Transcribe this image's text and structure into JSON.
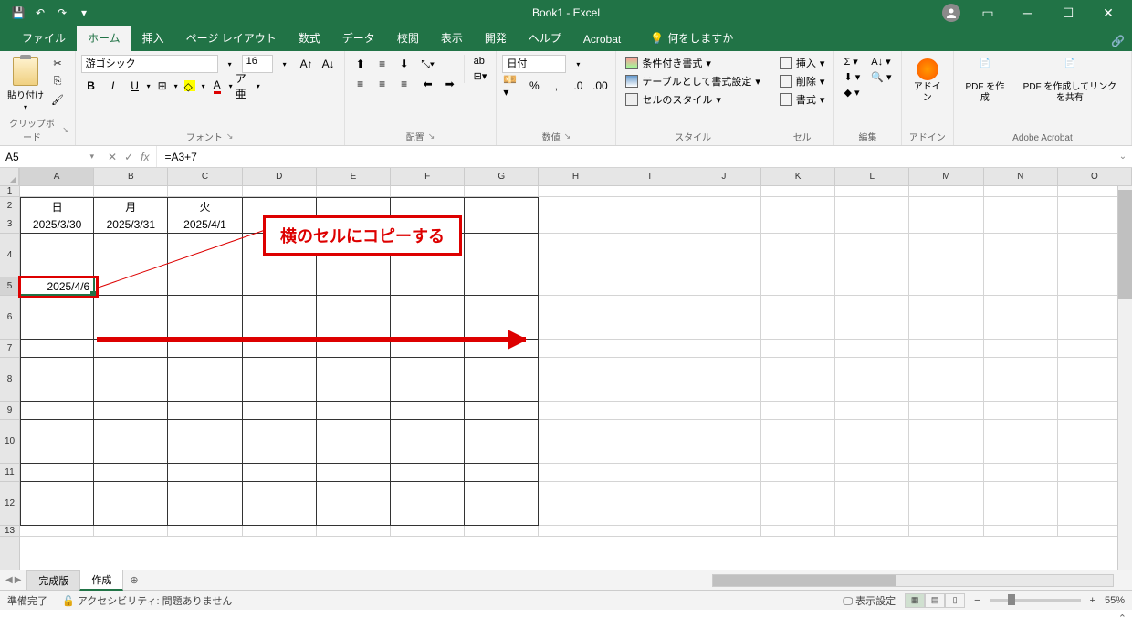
{
  "titlebar": {
    "title": "Book1 - Excel"
  },
  "tabs": {
    "file": "ファイル",
    "home": "ホーム",
    "insert": "挿入",
    "layout": "ページ レイアウト",
    "formulas": "数式",
    "data": "データ",
    "review": "校閲",
    "view": "表示",
    "dev": "開発",
    "help": "ヘルプ",
    "acrobat": "Acrobat",
    "tellme": "何をしますか"
  },
  "ribbon": {
    "paste": "貼り付け",
    "clipboard_label": "クリップボード",
    "font_name": "游ゴシック",
    "font_size": "16",
    "font_label": "フォント",
    "align_label": "配置",
    "wrap": "ab",
    "number_format": "日付",
    "number_label": "数値",
    "cond_fmt": "条件付き書式",
    "table_fmt": "テーブルとして書式設定",
    "cell_style": "セルのスタイル",
    "styles_label": "スタイル",
    "insert_cell": "挿入",
    "delete_cell": "削除",
    "format_cell": "書式",
    "cells_label": "セル",
    "edit_label": "編集",
    "addin": "アドイン",
    "addin_label": "アドイン",
    "pdf_create": "PDF を作成",
    "pdf_share": "PDF を作成してリンクを共有",
    "acrobat_label": "Adobe Acrobat"
  },
  "formula_bar": {
    "cell_ref": "A5",
    "formula": "=A3+7"
  },
  "columns": [
    "A",
    "B",
    "C",
    "D",
    "E",
    "F",
    "G",
    "H",
    "I",
    "J",
    "K",
    "L",
    "M",
    "N",
    "O"
  ],
  "rows": [
    "1",
    "2",
    "3",
    "4",
    "5",
    "6",
    "7",
    "8",
    "9",
    "10",
    "11",
    "12",
    "13"
  ],
  "cells": {
    "r2": {
      "A": "日",
      "B": "月",
      "C": "火"
    },
    "r3": {
      "A": "2025/3/30",
      "B": "2025/3/31",
      "C": "2025/4/1"
    },
    "r5": {
      "A": "2025/4/6"
    }
  },
  "annotation": {
    "text": "横のセルにコピーする"
  },
  "sheets": {
    "s1": "完成版",
    "s2": "作成"
  },
  "status": {
    "ready": "準備完了",
    "accessibility": "アクセシビリティ: 問題ありません",
    "display": "表示設定",
    "zoom": "55%"
  }
}
